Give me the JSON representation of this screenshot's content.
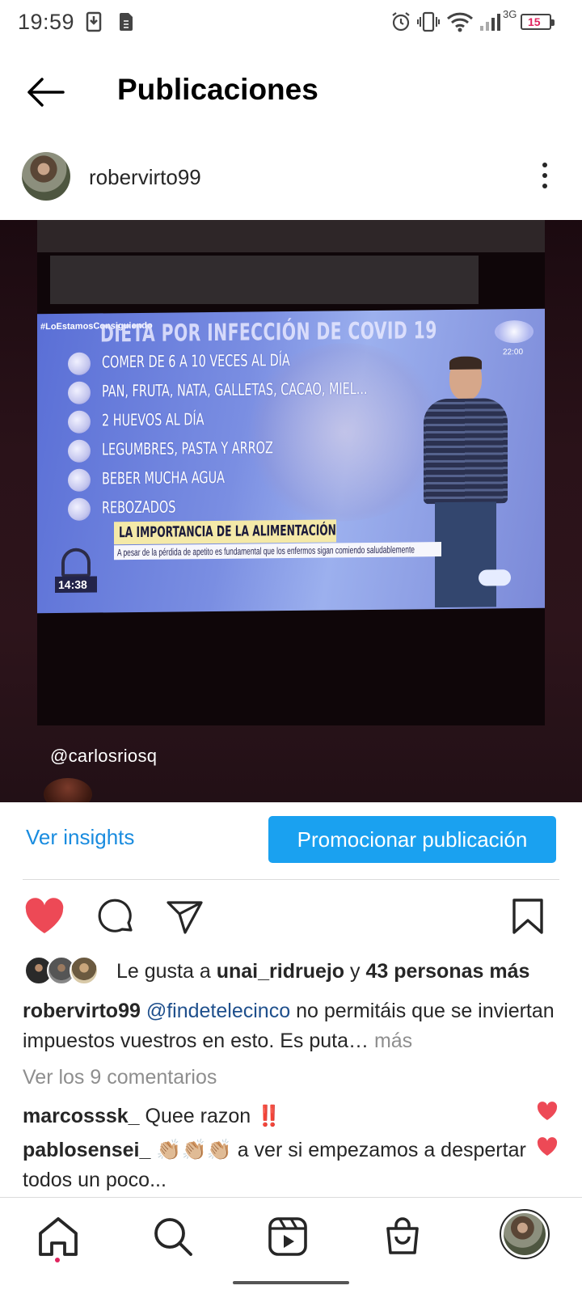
{
  "status_bar": {
    "time": "19:59",
    "network": "3G",
    "battery": "15",
    "icons": [
      "download-icon",
      "sim-icon",
      "alarm-icon",
      "vibrate-icon",
      "wifi-icon",
      "signal-icon",
      "battery-icon"
    ]
  },
  "header": {
    "back_icon": "arrow-left-icon",
    "title": "Publicaciones"
  },
  "post": {
    "username": "robervirto99",
    "more_icon": "more-vertical-icon",
    "image": {
      "hashtag": "#LoEstamosConsiguiendo",
      "title": "DIETA POR INFECCIÓN DE COVID 19",
      "items": [
        "COMER DE 6 A 10 VECES AL DÍA",
        "PAN, FRUTA, NATA, GALLETAS, CACAO, MIEL...",
        "2 HUEVOS AL DÍA",
        "LEGUMBRES, PASTA Y ARROZ",
        "BEBER MUCHA AGUA",
        "REBOZADOS"
      ],
      "logo_time": "22:00",
      "banner": "LA IMPORTANCIA DE LA ALIMENTACIÓN",
      "subtitle": "A pesar de la pérdida de apetito es fundamental que los enfermos sigan comiendo saludablemente",
      "clock": "14:38",
      "overlay_handle": "@carlosriosq"
    },
    "insights_label": "Ver insights",
    "promote_label": "Promocionar publicación",
    "likes": {
      "prefix": "Le gusta a",
      "user": "unai_ridruejo",
      "connector": "y",
      "others": "43 personas más"
    },
    "caption": {
      "user": "robervirto99",
      "mention": "@findetelecinco",
      "text": "no permitáis que se inviertan impuestos vuestros en esto. Es puta…",
      "more": "más"
    },
    "view_comments": "Ver los 9 comentarios",
    "comments": [
      {
        "user": "marcosssk_",
        "text": "Quee razon ‼️"
      },
      {
        "user": "pablosensei_",
        "text": "👏🏼👏🏼👏🏼 a ver si empezamos a despertar todos un poco..."
      }
    ]
  },
  "bottom_nav": [
    "home-icon",
    "search-icon",
    "reels-icon",
    "shop-icon",
    "profile-avatar"
  ],
  "colors": {
    "accent": "#1aa1f0",
    "link": "#1a8cdf",
    "like_red": "#ed4956"
  }
}
